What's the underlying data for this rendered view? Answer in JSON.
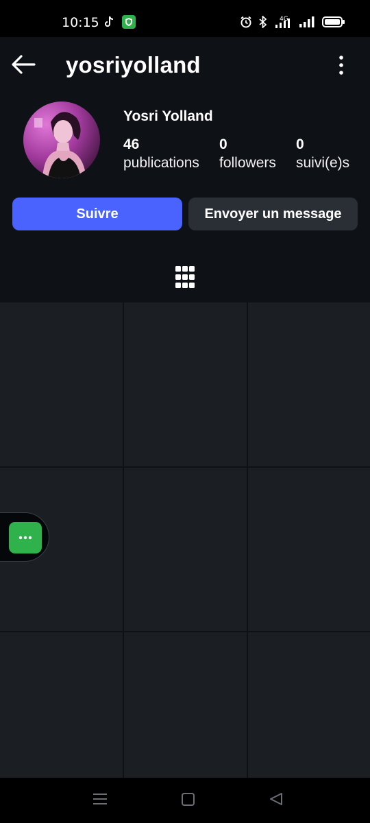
{
  "status_bar": {
    "time": "10:15",
    "icons_left": [
      "tiktok-icon",
      "security-shield-icon"
    ],
    "icons_right": [
      "alarm-icon",
      "bluetooth-icon",
      "4g-signal-icon",
      "signal-icon",
      "battery-icon"
    ],
    "network_label": "4G"
  },
  "header": {
    "username": "yosriyolland",
    "back_icon": "arrow-left-icon",
    "menu_icon": "more-vertical-icon"
  },
  "profile": {
    "display_name": "Yosri Yolland",
    "stats": [
      {
        "value": "46",
        "label": "publications"
      },
      {
        "value": "0",
        "label": "followers"
      },
      {
        "value": "0",
        "label": "suivi(e)s"
      }
    ]
  },
  "actions": {
    "follow_label": "Suivre",
    "message_label": "Envoyer un message"
  },
  "tabs": {
    "grid_icon": "grid-icon"
  },
  "posts": {
    "cells": 9
  },
  "colors": {
    "accent": "#4a63ff",
    "background": "#0e1115",
    "cell": "#1b1f24",
    "secondary_button": "#2a2f36",
    "widget_green": "#2fb24c"
  },
  "nav": {
    "items": [
      "recent-apps-icon",
      "home-icon",
      "back-icon"
    ]
  }
}
